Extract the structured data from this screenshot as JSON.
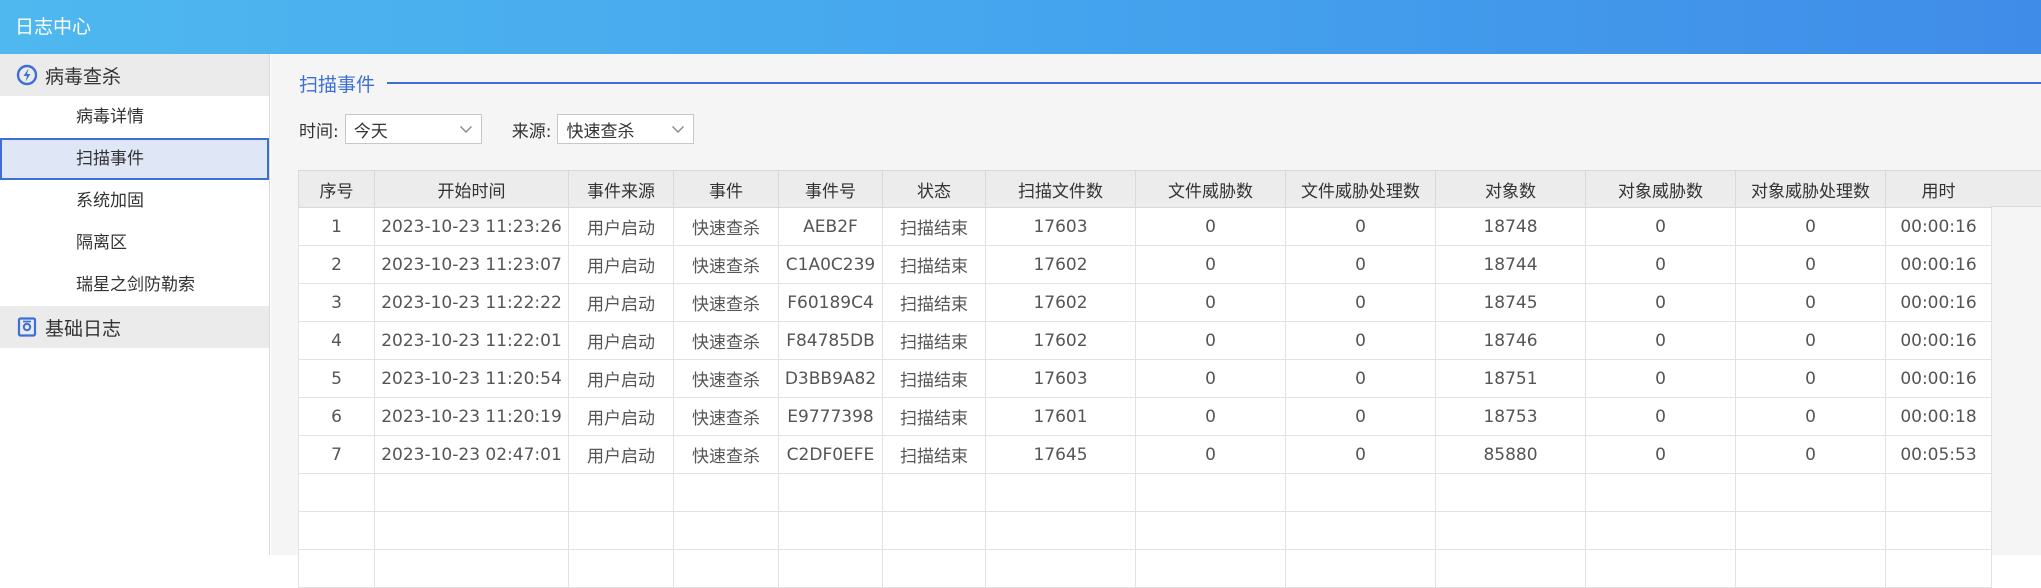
{
  "window": {
    "title": "日志中心"
  },
  "sidebar": {
    "groups": [
      {
        "label": "病毒查杀",
        "icon": "virus-scan-icon",
        "items": [
          "病毒详情",
          "扫描事件",
          "系统加固",
          "隔离区",
          "瑞星之剑防勒索"
        ],
        "active_index": 1
      },
      {
        "label": "基础日志",
        "icon": "base-log-icon"
      }
    ]
  },
  "section": {
    "title": "扫描事件"
  },
  "filters": {
    "time_label": "时间:",
    "time_value": "今天",
    "source_label": "来源:",
    "source_value": "快速查杀"
  },
  "table": {
    "columns": [
      "序号",
      "开始时间",
      "事件来源",
      "事件",
      "事件号",
      "状态",
      "扫描文件数",
      "文件威胁数",
      "文件威胁处理数",
      "对象数",
      "对象威胁数",
      "对象威胁处理数",
      "用时"
    ],
    "rows": [
      [
        "1",
        "2023-10-23 11:23:26",
        "用户启动",
        "快速查杀",
        "AEB2F",
        "扫描结束",
        "17603",
        "0",
        "0",
        "18748",
        "0",
        "0",
        "00:00:16"
      ],
      [
        "2",
        "2023-10-23 11:23:07",
        "用户启动",
        "快速查杀",
        "C1A0C239",
        "扫描结束",
        "17602",
        "0",
        "0",
        "18744",
        "0",
        "0",
        "00:00:16"
      ],
      [
        "3",
        "2023-10-23 11:22:22",
        "用户启动",
        "快速查杀",
        "F60189C4",
        "扫描结束",
        "17602",
        "0",
        "0",
        "18745",
        "0",
        "0",
        "00:00:16"
      ],
      [
        "4",
        "2023-10-23 11:22:01",
        "用户启动",
        "快速查杀",
        "F84785DB",
        "扫描结束",
        "17602",
        "0",
        "0",
        "18746",
        "0",
        "0",
        "00:00:16"
      ],
      [
        "5",
        "2023-10-23 11:20:54",
        "用户启动",
        "快速查杀",
        "D3BB9A82",
        "扫描结束",
        "17603",
        "0",
        "0",
        "18751",
        "0",
        "0",
        "00:00:16"
      ],
      [
        "6",
        "2023-10-23 11:20:19",
        "用户启动",
        "快速查杀",
        "E9777398",
        "扫描结束",
        "17601",
        "0",
        "0",
        "18753",
        "0",
        "0",
        "00:00:18"
      ],
      [
        "7",
        "2023-10-23 02:47:01",
        "用户启动",
        "快速查杀",
        "C2DF0EFE",
        "扫描结束",
        "17645",
        "0",
        "0",
        "85880",
        "0",
        "0",
        "00:05:53"
      ]
    ],
    "empty_rows": 3
  },
  "colors": {
    "accent": "#3d6fd6",
    "titlebar_start": "#4fb8ef",
    "titlebar_end": "#3f8ce8"
  }
}
